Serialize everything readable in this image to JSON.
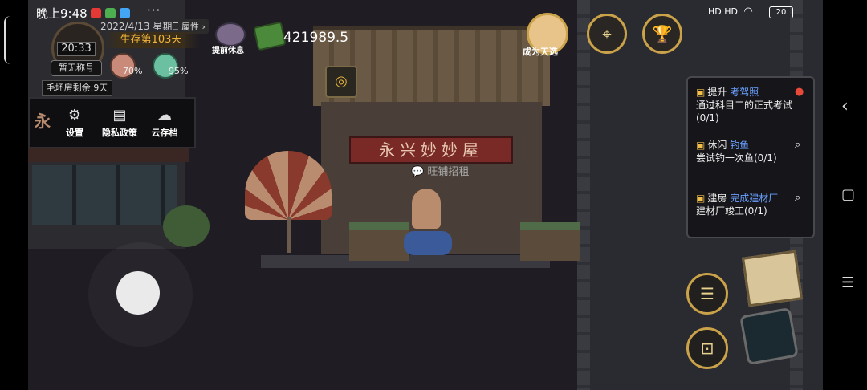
{
  "status_bar": {
    "time": "晚上9:48",
    "signal": "HD HD",
    "battery": "20"
  },
  "hud": {
    "date": "2022/4/13 星期三",
    "attributes_label": "属性",
    "survival": "生存第103天",
    "clock_time": "20:33",
    "title_badge": "暂无称号",
    "mood_percent": "70%",
    "health_percent": "95%",
    "rent_info": "毛坯房剩余:9天",
    "rest_label": "提前休息",
    "money": "421989.5"
  },
  "menu": {
    "settings": "设置",
    "privacy": "隐私政策",
    "cloud_save": "云存档"
  },
  "top_actions": {
    "become_chosen_label": "成为天选"
  },
  "scene": {
    "shop_sign": "永兴妙妙屋",
    "shop_rent_notice": "旺铺招租"
  },
  "quests": [
    {
      "category": "提升",
      "highlight": "考驾照",
      "desc": "通过科目二的正式考试(0/1)",
      "icon": "location-pin-icon"
    },
    {
      "category": "休闲",
      "highlight": "钓鱼",
      "desc": "尝试钓一次鱼(0/1)",
      "icon": "search-icon"
    },
    {
      "category": "建房",
      "highlight": "完成建材厂",
      "desc": "建材厂竣工(0/1)",
      "icon": "search-icon"
    }
  ],
  "colors": {
    "gold": "#c9a24a",
    "quest_key": "#f2c04a",
    "quest_highlight": "#6aa0ff",
    "survival_text": "#f0b23c"
  }
}
